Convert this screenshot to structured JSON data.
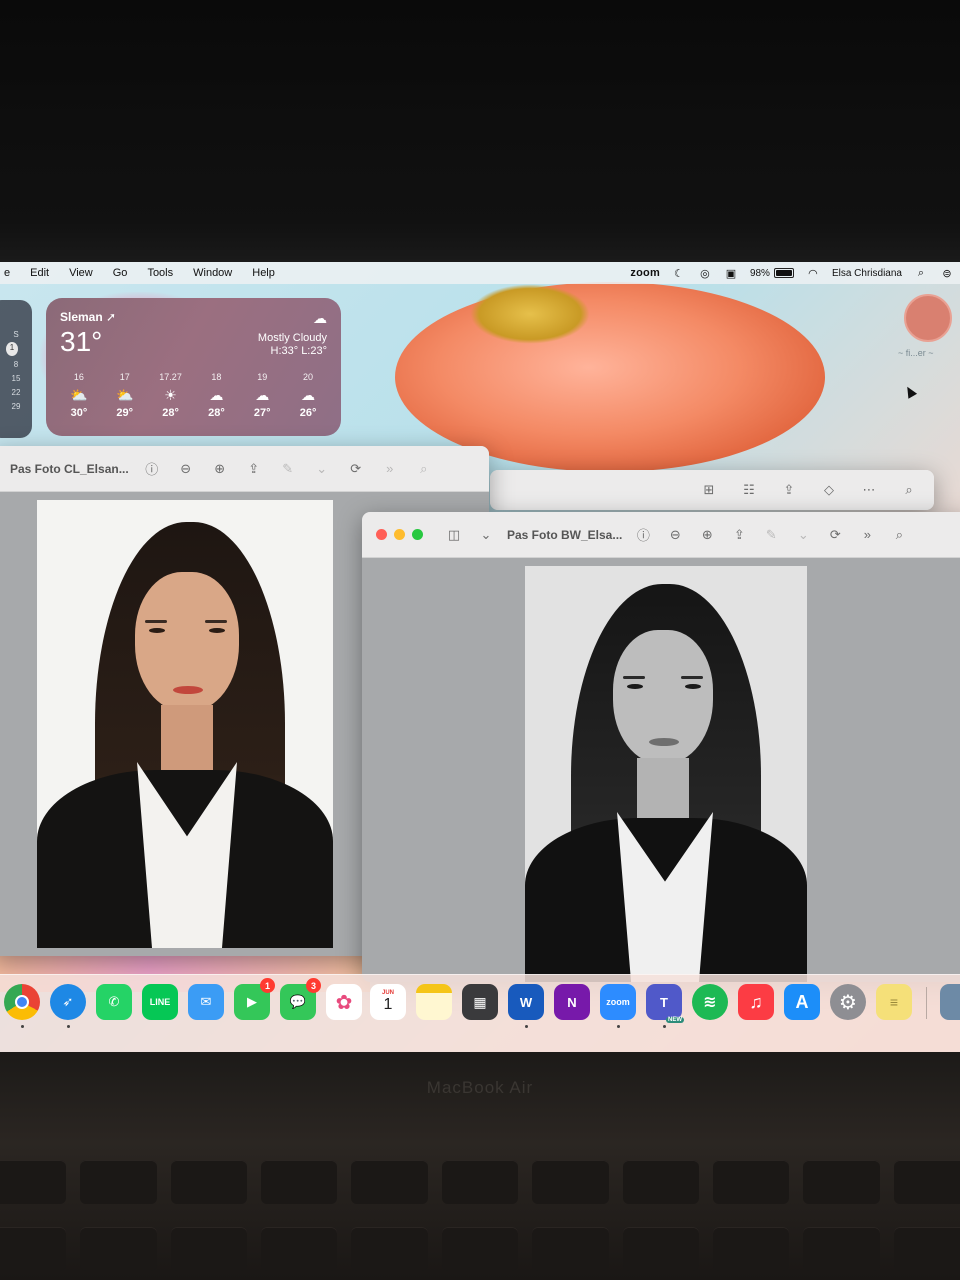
{
  "menubar": {
    "items": [
      "e",
      "Edit",
      "View",
      "Go",
      "Tools",
      "Window",
      "Help"
    ],
    "zoom": "zoom",
    "battery_percent": "98%",
    "battery_level": 0.98,
    "user": "Elsa Chrisdiana"
  },
  "calendar_widget": {
    "days": [
      "S",
      "1",
      "8",
      "15",
      "22",
      "29"
    ]
  },
  "weather": {
    "city": "Sleman",
    "temperature": "31°",
    "condition": "Mostly Cloudy",
    "high_low": "H:33° L:23°",
    "forecast": [
      {
        "time": "16",
        "icon": "sun-cloud-icon",
        "temp": "30°"
      },
      {
        "time": "17",
        "icon": "sun-cloud-icon",
        "temp": "29°"
      },
      {
        "time": "17.27",
        "icon": "sunset-icon",
        "temp": "28°"
      },
      {
        "time": "18",
        "icon": "moon-cloud-icon",
        "temp": "28°"
      },
      {
        "time": "19",
        "icon": "moon-cloud-icon",
        "temp": "27°"
      },
      {
        "time": "20",
        "icon": "cloud-icon",
        "temp": "26°"
      }
    ]
  },
  "desktop": {
    "avatar_label": "~ fi...er ~"
  },
  "windows": {
    "color_photo": {
      "title": "Pas Foto CL_Elsan..."
    },
    "bw_photo": {
      "title": "Pas Foto BW_Elsa..."
    }
  },
  "dock": {
    "apps": [
      {
        "name": "Chrome",
        "label": "",
        "color": "#ffffff",
        "running": true
      },
      {
        "name": "Safari",
        "label": "",
        "color": "#1e88e5",
        "running": true
      },
      {
        "name": "WhatsApp",
        "label": "",
        "color": "#25d366",
        "running": false
      },
      {
        "name": "LINE",
        "label": "LINE",
        "color": "#06c755",
        "running": false
      },
      {
        "name": "Mail",
        "label": "",
        "color": "#3b9cf5",
        "running": false
      },
      {
        "name": "FaceTime",
        "label": "",
        "color": "#34c759",
        "running": false,
        "badge": "1"
      },
      {
        "name": "Messages",
        "label": "",
        "color": "#34c759",
        "running": false,
        "badge": "3"
      },
      {
        "name": "Photos",
        "label": "",
        "color": "#ffffff",
        "running": false
      },
      {
        "name": "Calendar",
        "label": "1",
        "month": "JUN",
        "color": "#ffffff",
        "running": false
      },
      {
        "name": "Notes",
        "label": "",
        "color": "#fff7d1",
        "running": false
      },
      {
        "name": "Calculator",
        "label": "",
        "color": "#3a3a3c",
        "running": false
      },
      {
        "name": "Word",
        "label": "W",
        "color": "#185abd",
        "running": true
      },
      {
        "name": "OneNote",
        "label": "N",
        "color": "#7719aa",
        "running": false
      },
      {
        "name": "Zoom",
        "label": "zoom",
        "color": "#2d8cff",
        "running": true
      },
      {
        "name": "Teams",
        "label": "T",
        "color": "#5059c9",
        "running": true,
        "tag": "NEW"
      },
      {
        "name": "Spotify",
        "label": "",
        "color": "#1db954",
        "running": false
      },
      {
        "name": "Music",
        "label": "♫",
        "color": "#fc3c44",
        "running": false
      },
      {
        "name": "App Store",
        "label": "A",
        "color": "#1c8ef9",
        "running": false
      },
      {
        "name": "System Settings",
        "label": "⚙",
        "color": "#8e8e93",
        "running": false
      },
      {
        "name": "Stickies",
        "label": "",
        "color": "#f5e079",
        "running": false
      }
    ]
  },
  "hardware": {
    "label": "MacBook Air"
  }
}
